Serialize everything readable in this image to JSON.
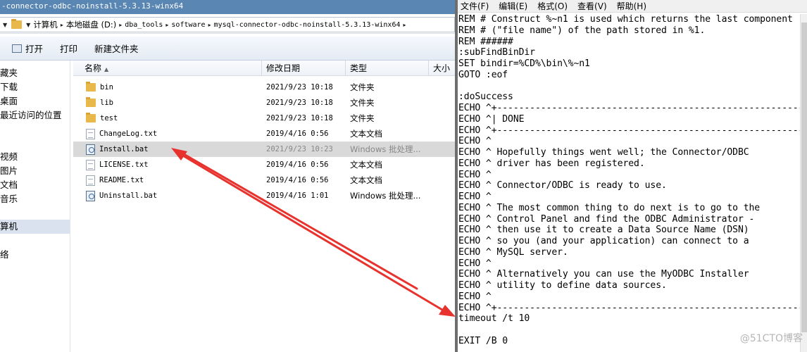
{
  "explorer": {
    "title": "-connector-odbc-noinstall-5.3.13-winx64",
    "address": {
      "computer": "计算机",
      "disk": "本地磁盘 (D:)",
      "dba_tools": "dba_tools",
      "software": "software",
      "folder": "mysql-connector-odbc-noinstall-5.3.13-winx64"
    },
    "toolbar": {
      "open_label": "打开",
      "print_label": "打印",
      "new_folder_label": "新建文件夹"
    },
    "nav": {
      "items": [
        {
          "label": "藏夹"
        },
        {
          "label": "下载"
        },
        {
          "label": "桌面"
        },
        {
          "label": "最近访问的位置"
        },
        {
          "label": "视频"
        },
        {
          "label": "图片"
        },
        {
          "label": "文档"
        },
        {
          "label": "音乐"
        },
        {
          "label": "算机"
        },
        {
          "label": "络"
        }
      ]
    },
    "columns": {
      "name": "名称",
      "modified": "修改日期",
      "type": "类型",
      "size": "大小"
    },
    "files": [
      {
        "name": "bin",
        "date": "2021/9/23 10:18",
        "type": "文件夹",
        "icon": "folder-icon"
      },
      {
        "name": "lib",
        "date": "2021/9/23 10:18",
        "type": "文件夹",
        "icon": "folder-icon"
      },
      {
        "name": "test",
        "date": "2021/9/23 10:18",
        "type": "文件夹",
        "icon": "folder-icon"
      },
      {
        "name": "ChangeLog.txt",
        "date": "2019/4/16 0:56",
        "type": "文本文档",
        "icon": "text-file-icon"
      },
      {
        "name": "Install.bat",
        "date": "2021/9/23 10:23",
        "type": "Windows 批处理...",
        "icon": "batch-file-icon"
      },
      {
        "name": "LICENSE.txt",
        "date": "2019/4/16 0:56",
        "type": "文本文档",
        "icon": "text-file-icon"
      },
      {
        "name": "README.txt",
        "date": "2019/4/16 0:56",
        "type": "文本文档",
        "icon": "text-file-icon"
      },
      {
        "name": "Uninstall.bat",
        "date": "2019/4/16 1:01",
        "type": "Windows 批处理...",
        "icon": "batch-file-icon"
      }
    ],
    "selected_file": "Install.bat"
  },
  "notepad": {
    "menu": {
      "file": "文件(F)",
      "edit": "编辑(E)",
      "format": "格式(O)",
      "view": "查看(V)",
      "help": "帮助(H)"
    },
    "lines": [
      "REM # Construct %~n1 is used which returns the last component",
      "REM # (\"file name\") of the path stored in %1.",
      "REM ######",
      ":subFindBinDir",
      "SET bindir=%CD%\\bin\\%~n1",
      "GOTO :eof",
      "",
      ":doSuccess",
      "ECHO ^+---------------------------------------------------------^+",
      "ECHO ^| DONE                                                     ^|",
      "ECHO ^+---------------------------------------------------------^+",
      "ECHO ^",
      "ECHO ^ Hopefully things went well; the Connector/ODBC",
      "ECHO ^ driver has been registered.",
      "ECHO ^",
      "ECHO ^ Connector/ODBC is ready to use.",
      "ECHO ^",
      "ECHO ^ The most common thing to do next is to go to the",
      "ECHO ^ Control Panel and find the ODBC Administrator -",
      "ECHO ^ then use it to create a Data Source Name (DSN)",
      "ECHO ^ so you (and your application) can connect to a",
      "ECHO ^ MySQL server.",
      "ECHO ^",
      "ECHO ^ Alternatively you can use the MyODBC Installer",
      "ECHO ^ utility to define data sources.",
      "ECHO ^",
      "ECHO ^+---------------------------------------------------------^+",
      "timeout /t 10",
      "",
      "EXIT /B 0"
    ]
  },
  "watermark": "@51CTO博客",
  "annotation_color": "#e8322e"
}
